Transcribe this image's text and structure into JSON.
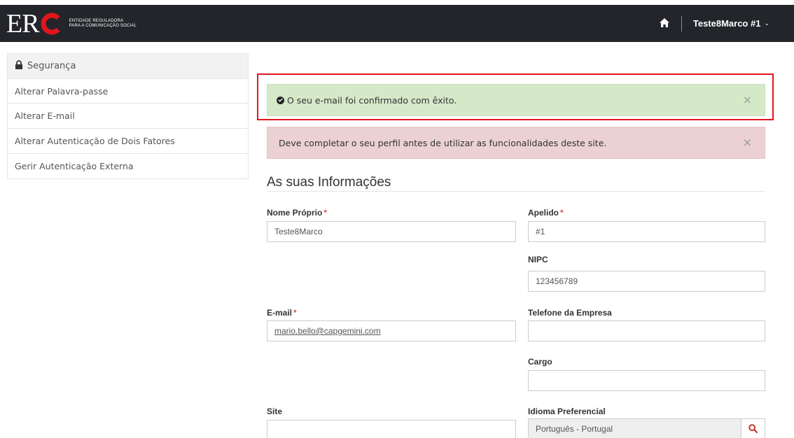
{
  "header": {
    "logo_letters": "ER",
    "logo_line1": "ENTIDADE REGULADORA",
    "logo_line2": "PARA A COMUNICAÇÃO SOCIAL",
    "user_name": "Teste8Marco #1",
    "caret": "⌄"
  },
  "sidebar": {
    "title": "Segurança",
    "items": [
      {
        "label": "Alterar Palavra-passe"
      },
      {
        "label": "Alterar E-mail"
      },
      {
        "label": "Alterar Autenticação de Dois Fatores"
      },
      {
        "label": "Gerir Autenticação Externa"
      }
    ]
  },
  "alerts": {
    "success": "O seu e-mail foi confirmado com êxito.",
    "danger": "Deve completar o seu perfil antes de utilizar as funcionalidades deste site.",
    "close": "×"
  },
  "form": {
    "title": "As suas Informações",
    "required_mark": "*",
    "first_name": {
      "label": "Nome Próprio",
      "value": "Teste8Marco"
    },
    "last_name": {
      "label": "Apelido",
      "value": "#1"
    },
    "nipc": {
      "label": "NIPC",
      "value": "123456789"
    },
    "email": {
      "label": "E-mail",
      "value": "mario.bello@capgemini.com"
    },
    "company_phone": {
      "label": "Telefone da Empresa",
      "value": ""
    },
    "role": {
      "label": "Cargo",
      "value": ""
    },
    "site": {
      "label": "Site",
      "value": ""
    },
    "language": {
      "label": "Idioma Preferencial",
      "value": "Português - Portugal"
    }
  },
  "colors": {
    "topbar": "#23252a",
    "brand_red": "#e0161d",
    "success_bg": "#d5e9c9",
    "danger_bg": "#ebd1d3"
  },
  "icons": {
    "home": "home-icon",
    "lock": "lock-icon",
    "check": "check-circle-icon",
    "search": "search-icon"
  }
}
